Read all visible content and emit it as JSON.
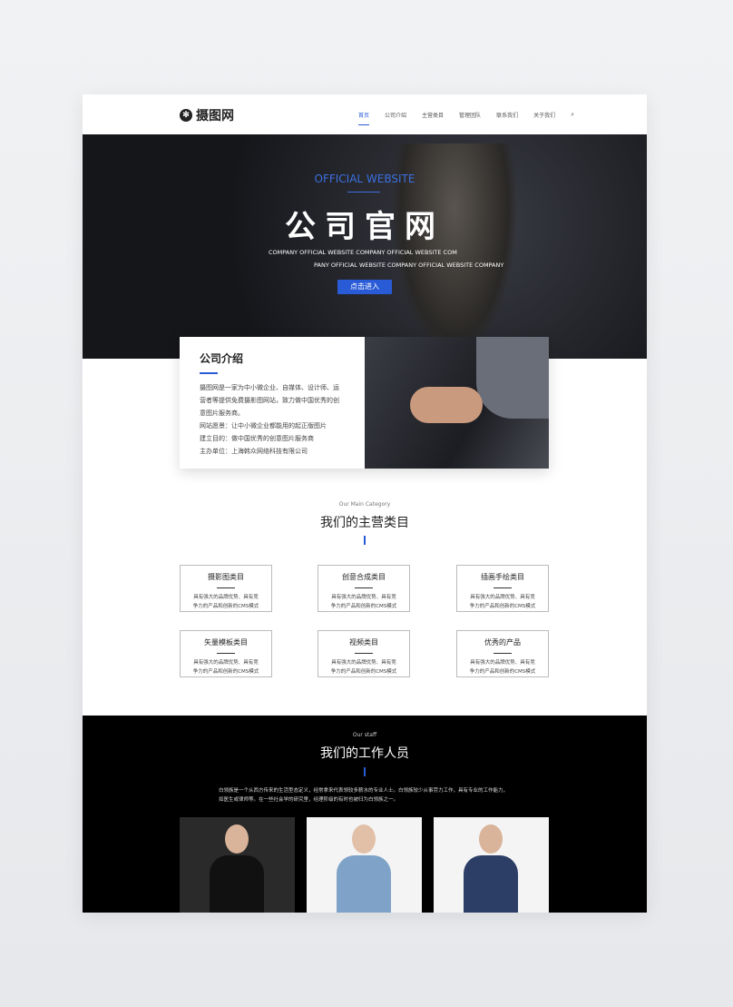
{
  "header": {
    "logo": "摄图网",
    "nav": [
      "首页",
      "公司介绍",
      "主营类目",
      "管理团队",
      "联系我们",
      "关于我们"
    ]
  },
  "hero": {
    "en_title": "OFFICIAL WEBSITE",
    "title": "公司官网",
    "sub1": "COMPANY OFFICIAL WEBSITE COMPANY OFFICIAL WEBSITE COM",
    "sub2": "PANY OFFICIAL WEBSITE COMPANY OFFICIAL WEBSITE COMPANY",
    "button": "点击进入"
  },
  "intro": {
    "title": "公司介绍",
    "body": "摄图网是一家为中小微企业、自媒体、设计师、运营者等提供免费摄影图网站，致力做中国优秀的创意图片服务商。",
    "vision": "网站愿景：让中小微企业都能用的起正版图片",
    "goal": "建立目的：做中国优秀的创意图片服务商",
    "host": "主办单位：上海韩众网络科技有限公司"
  },
  "categories": {
    "subtitle": "Our Main Category",
    "title": "我们的主营类目",
    "items": [
      {
        "name": "摄影图类目",
        "line1": "具有强大的品牌优势、具有竞",
        "line2": "争力的产品和创新的CMS模式"
      },
      {
        "name": "创意合成类目",
        "line1": "具有强大的品牌优势、具有竞",
        "line2": "争力的产品和创新的CMS模式"
      },
      {
        "name": "插画手绘类目",
        "line1": "具有强大的品牌优势、具有竞",
        "line2": "争力的产品和创新的CMS模式"
      },
      {
        "name": "矢量模板类目",
        "line1": "具有强大的品牌优势、具有竞",
        "line2": "争力的产品和创新的CMS模式"
      },
      {
        "name": "视频类目",
        "line1": "具有强大的品牌优势、具有竞",
        "line2": "争力的产品和创新的CMS模式"
      },
      {
        "name": "优秀的产品",
        "line1": "具有强大的品牌优势、具有竞",
        "line2": "争力的产品和创新的CMS模式"
      }
    ]
  },
  "staff": {
    "subtitle": "Our staff",
    "title": "我们的工作人员",
    "desc": "白领族是一个从西方传来的生活型态定义，经常拿来代表领较多薪水的专业人士。白领族较少从事劳力工作，具有专业的工作能力，如医生或律师等。在一些社会学的研究里，经理阶级的有时也被归为白领族之一。"
  },
  "colors": {
    "accent": "#2a5bd7"
  }
}
